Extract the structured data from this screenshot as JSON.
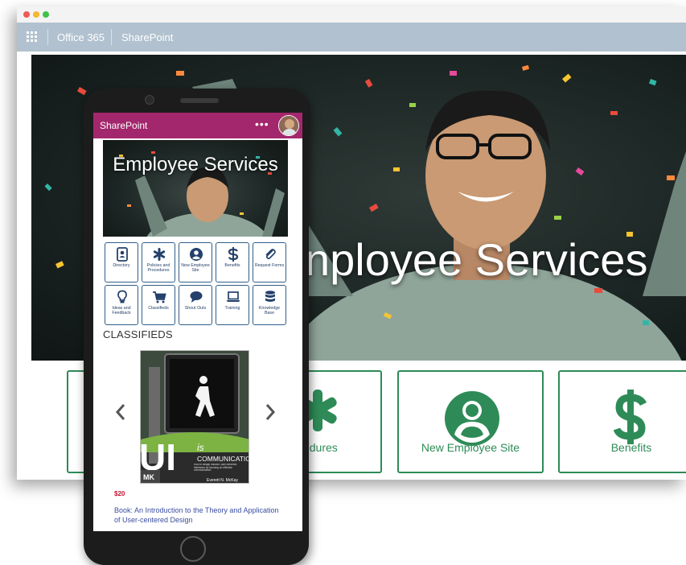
{
  "suite_bar": {
    "app_name": "Office 365",
    "site_name": "SharePoint"
  },
  "hero": {
    "title": "nployee Services"
  },
  "desktop_tiles": [
    {
      "label": "Procedures",
      "icon": "asterisk-icon"
    },
    {
      "label": "New Employee Site",
      "icon": "person-icon"
    },
    {
      "label": "Benefits",
      "icon": "dollar-icon"
    }
  ],
  "phone": {
    "header_title": "SharePoint",
    "more_label": "•••",
    "hero_title": "Employee Services",
    "quick_links": [
      {
        "label": "Directory",
        "icon": "directory-icon"
      },
      {
        "label": "Policies and Procedures",
        "icon": "asterisk-icon"
      },
      {
        "label": "New Employee Site",
        "icon": "person-icon"
      },
      {
        "label": "Benefits",
        "icon": "dollar-icon"
      },
      {
        "label": "Request Forms",
        "icon": "paperclip-icon"
      },
      {
        "label": "Ideas and Feedback",
        "icon": "lightbulb-icon"
      },
      {
        "label": "Classifieds",
        "icon": "cart-icon"
      },
      {
        "label": "Shout Outs",
        "icon": "chat-icon"
      },
      {
        "label": "Training",
        "icon": "laptop-icon"
      },
      {
        "label": "Knowledge Base",
        "icon": "database-icon"
      }
    ],
    "classifieds_title": "CLASSIFIEDS",
    "book_cover": {
      "title_big": "UI",
      "title_is": "is",
      "title_sub": "COMMUNICATION",
      "tagline": "How to design intuitive, user-centered interfaces by focusing on effective communication",
      "author": "Everett N. McKay",
      "publisher": "MK"
    },
    "price": "$20",
    "item_caption": "Book: An Introduction to the Theory and Application of User-centered Design"
  },
  "colors": {
    "accent": "#2e8b57",
    "header": "#a3276d",
    "suite": "#b1c1cf",
    "link": "#3a4ea0",
    "price": "#c8102e"
  }
}
